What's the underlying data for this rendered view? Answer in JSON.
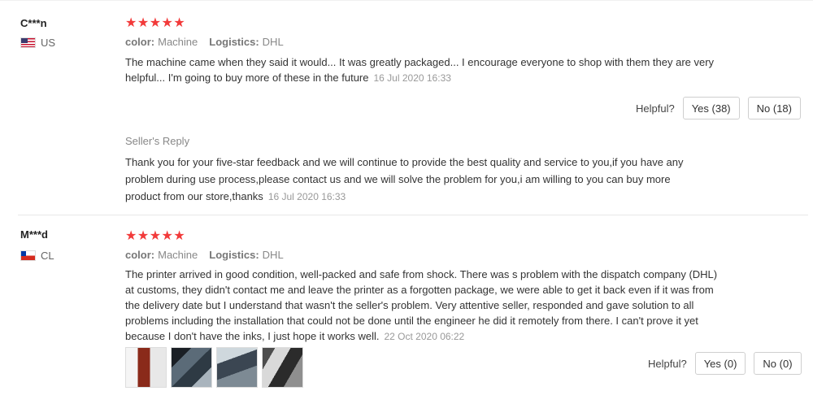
{
  "reviews": [
    {
      "user": "C***n",
      "country": "US",
      "stars": "★★★★★",
      "color_label": "color:",
      "color_value": "Machine",
      "logistics_label": "Logistics:",
      "logistics_value": "DHL",
      "text": "The machine came when they said it would... It was greatly packaged... I encourage everyone to shop with them they are very helpful... I'm going to buy more of these in the future",
      "date": "16 Jul 2020 16:33",
      "helpful_label": "Helpful?",
      "yes_label": "Yes (38)",
      "no_label": "No (18)",
      "seller_reply": {
        "title": "Seller's Reply",
        "text": "Thank you for your five-star feedback and we will continue to provide the best quality and service to you,if you have any problem during use process,please contact us and we will solve the problem for you,i am willing to you can buy more product from our store,thanks",
        "date": "16 Jul 2020 16:33"
      }
    },
    {
      "user": "M***d",
      "country": "CL",
      "stars": "★★★★★",
      "color_label": "color:",
      "color_value": "Machine",
      "logistics_label": "Logistics:",
      "logistics_value": "DHL",
      "text": "The printer arrived in good condition, well-packed and safe from shock. There was s problem with the dispatch company (DHL) at customs, they didn't contact me and leave the printer as a forgotten package, we were able to get it back even if it was from the delivery date but I understand that wasn't the seller's problem. Very attentive seller, responded and gave solution to all problems including the installation that could not be done until the engineer he did it remotely from there. I can't prove it yet because I don't have the inks, I just hope it works well.",
      "date": "22 Oct 2020 06:22",
      "helpful_label": "Helpful?",
      "yes_label": "Yes (0)",
      "no_label": "No (0)"
    }
  ],
  "colors": {
    "star": "#f23a3a",
    "muted": "#999999",
    "border": "#cfcfcf"
  }
}
